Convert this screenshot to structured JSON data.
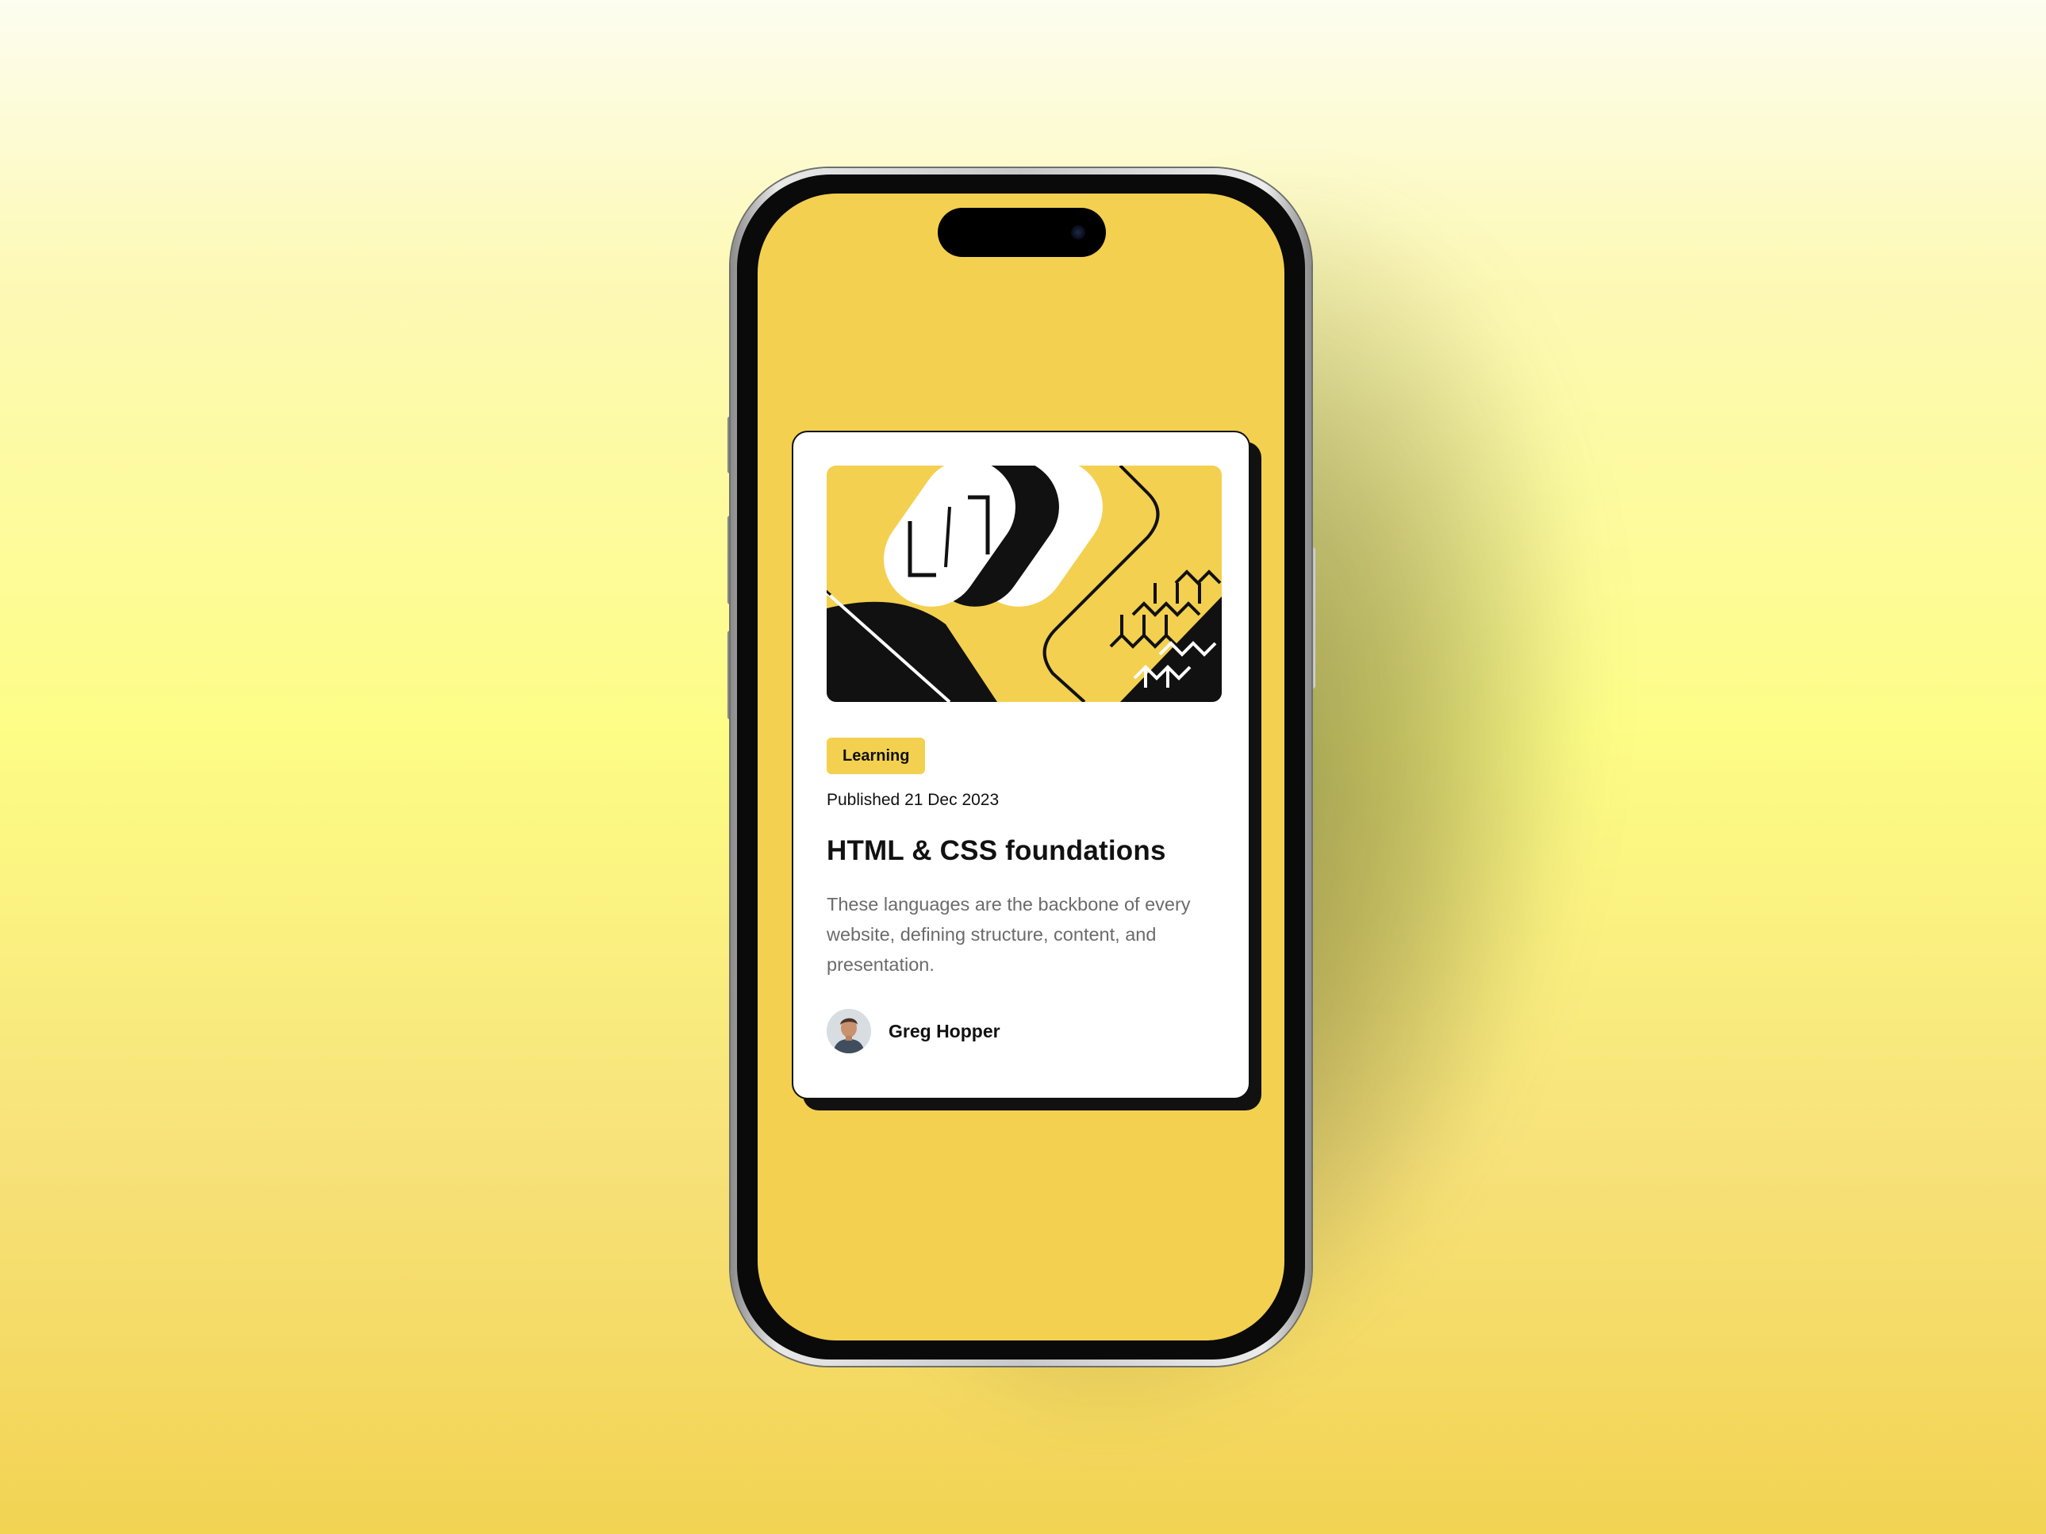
{
  "card": {
    "category": "Learning",
    "published": "Published 21 Dec 2023",
    "title": "HTML & CSS foundations",
    "description": "These languages are the backbone of every website, defining structure, content, and presentation.",
    "author": {
      "name": "Greg Hopper"
    }
  },
  "colors": {
    "accent_yellow": "#f3d04f",
    "ink": "#111111",
    "muted_text": "#6b6b6b",
    "card_background": "#ffffff"
  },
  "icons": {
    "hero_illustration": "abstract-code-illustration",
    "avatar": "author-avatar"
  }
}
